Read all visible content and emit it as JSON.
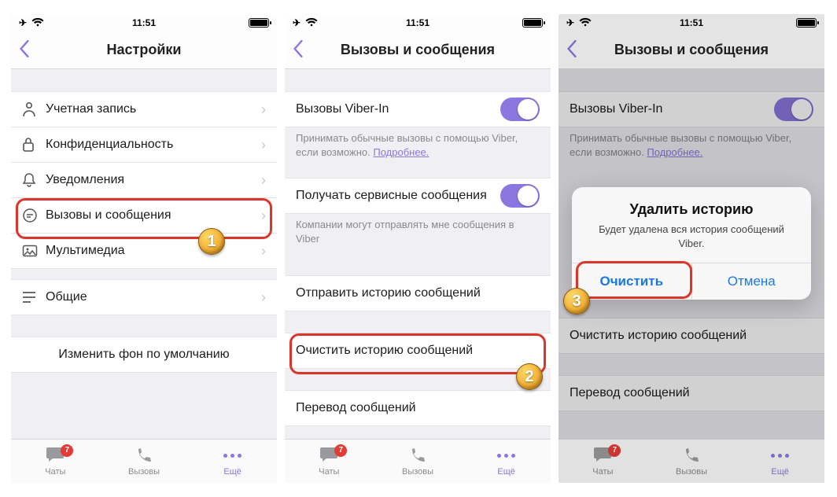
{
  "status": {
    "time": "11:51"
  },
  "screen1": {
    "title": "Настройки",
    "rows": {
      "account": "Учетная запись",
      "privacy": "Конфиденциальность",
      "notifications": "Уведомления",
      "calls_msgs": "Вызовы и сообщения",
      "media": "Мультимедиа",
      "general": "Общие",
      "change_bg": "Изменить фон по умолчанию"
    }
  },
  "screen2": {
    "title": "Вызовы и сообщения",
    "viber_in_label": "Вызовы Viber-In",
    "viber_in_desc": "Принимать обычные вызовы с помощью Viber, если возможно. ",
    "more": "Подробнее.",
    "service_msgs_label": "Получать сервисные сообщения",
    "service_msgs_desc": "Компании могут отправлять мне сообщения в Viber",
    "send_history": "Отправить историю сообщений",
    "clear_history": "Очистить историю сообщений",
    "translate": "Перевод сообщений"
  },
  "screen3": {
    "title": "Вызовы и сообщения",
    "alert": {
      "title": "Удалить историю",
      "message": "Будет удалена вся история сообщений Viber.",
      "confirm": "Очистить",
      "cancel": "Отмена"
    }
  },
  "tabs": {
    "chats": "Чаты",
    "calls": "Вызовы",
    "more": "Ещё",
    "chats_badge": "7"
  },
  "markers": {
    "n1": "1",
    "n2": "2",
    "n3": "3"
  }
}
